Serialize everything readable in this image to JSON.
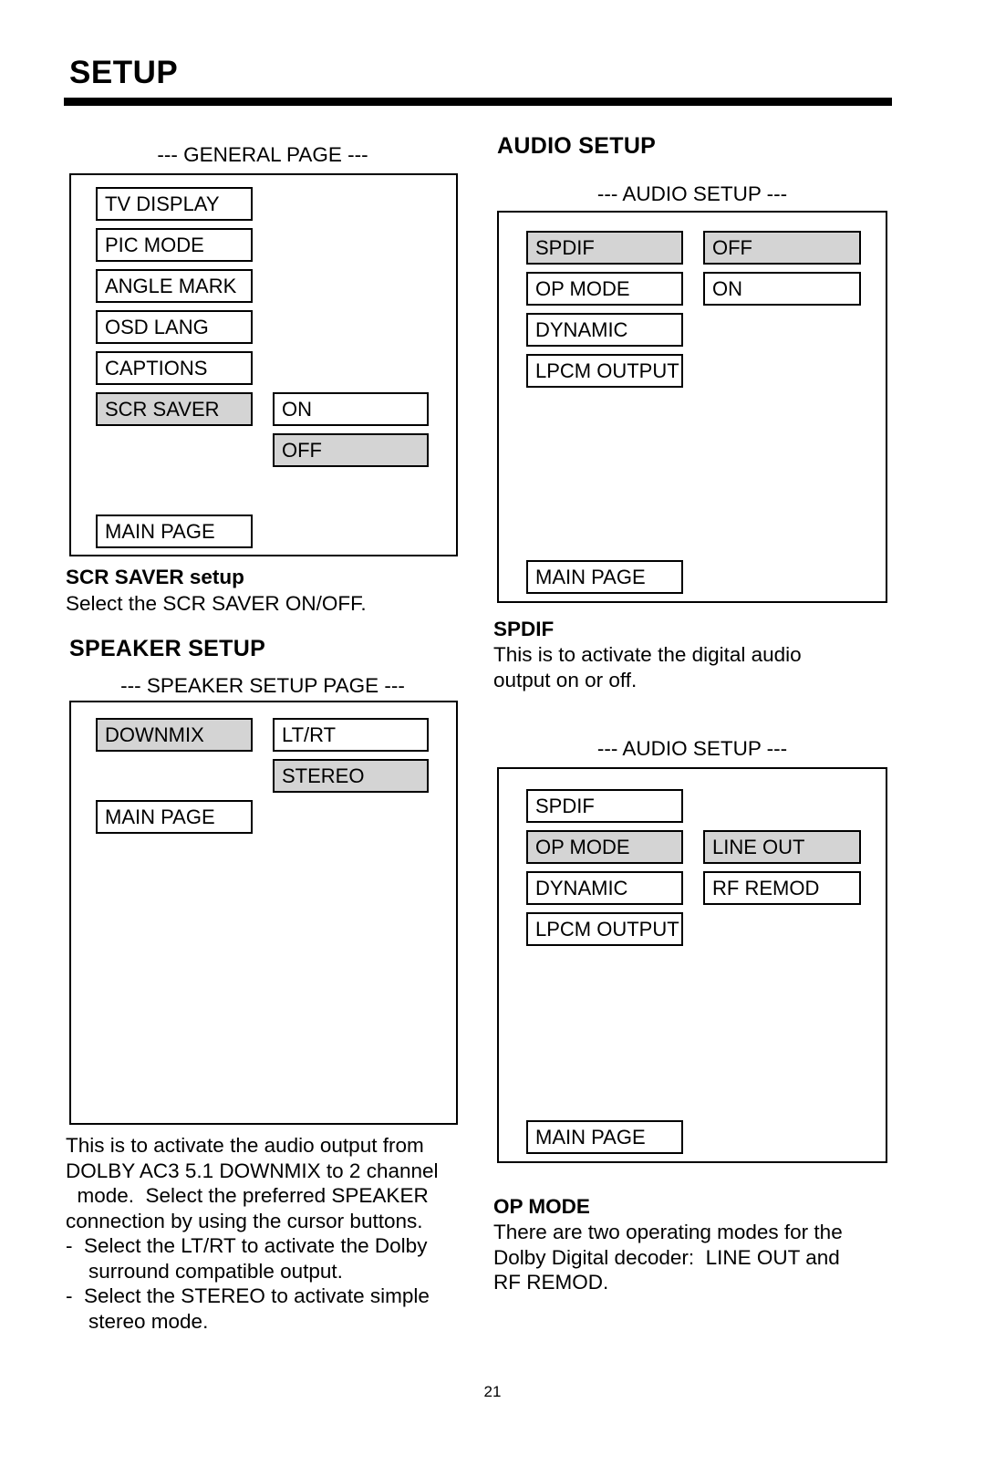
{
  "page": {
    "title": "SETUP",
    "number": "21"
  },
  "left_column": {
    "general_screen": {
      "caption": "--- GENERAL PAGE ---",
      "menu_items": [
        {
          "label": "TV DISPLAY",
          "highlighted": false
        },
        {
          "label": "PIC MODE",
          "highlighted": false
        },
        {
          "label": "ANGLE MARK",
          "highlighted": false
        },
        {
          "label": "OSD LANG",
          "highlighted": false
        },
        {
          "label": "CAPTIONS",
          "highlighted": false
        },
        {
          "label": "SCR SAVER",
          "highlighted": true
        }
      ],
      "options": [
        {
          "label": "ON",
          "highlighted": false
        },
        {
          "label": "OFF",
          "highlighted": true
        }
      ],
      "main_page_label": "MAIN PAGE"
    },
    "scr_saver": {
      "heading": "SCR SAVER setup",
      "description": "Select the SCR SAVER ON/OFF."
    },
    "speaker_setup": {
      "heading": "SPEAKER SETUP",
      "caption": "--- SPEAKER SETUP PAGE ---",
      "menu_items": [
        {
          "label": "DOWNMIX",
          "highlighted": true
        }
      ],
      "options": [
        {
          "label": "LT/RT",
          "highlighted": false
        },
        {
          "label": "STEREO",
          "highlighted": true
        }
      ],
      "main_page_label": "MAIN PAGE",
      "description_lines": [
        "This is to activate the audio output from",
        "DOLBY AC3 5.1 DOWNMIX to 2 channel",
        "  mode.  Select the preferred SPEAKER",
        "connection by using the cursor buttons.",
        "-  Select the LT/RT to activate the Dolby",
        "    surround compatible output.",
        "-  Select the STEREO to activate simple",
        "    stereo mode."
      ]
    }
  },
  "right_column": {
    "audio_setup": {
      "heading": "AUDIO SETUP"
    },
    "audio_screen_spdif": {
      "caption": "--- AUDIO SETUP ---",
      "menu_items": [
        {
          "label": "SPDIF",
          "highlighted": true
        },
        {
          "label": "OP MODE",
          "highlighted": false
        },
        {
          "label": "DYNAMIC",
          "highlighted": false
        },
        {
          "label": "LPCM OUTPUT",
          "highlighted": false
        }
      ],
      "options": [
        {
          "label": "OFF",
          "highlighted": true
        },
        {
          "label": "ON",
          "highlighted": false
        }
      ],
      "main_page_label": "MAIN PAGE"
    },
    "spdif": {
      "heading": "SPDIF",
      "description_lines": [
        "This is to activate the digital audio",
        "output on or off."
      ]
    },
    "audio_screen_opmode": {
      "caption": "--- AUDIO SETUP ---",
      "menu_items": [
        {
          "label": "SPDIF",
          "highlighted": false
        },
        {
          "label": "OP MODE",
          "highlighted": true
        },
        {
          "label": "DYNAMIC",
          "highlighted": false
        },
        {
          "label": "LPCM OUTPUT",
          "highlighted": false
        }
      ],
      "options": [
        {
          "label": "LINE OUT",
          "highlighted": true
        },
        {
          "label": "RF REMOD",
          "highlighted": false
        }
      ],
      "main_page_label": "MAIN PAGE"
    },
    "op_mode": {
      "heading": "OP MODE",
      "description_lines": [
        "There are two operating modes for the",
        "Dolby Digital decoder:  LINE OUT and",
        "RF REMOD."
      ]
    }
  }
}
